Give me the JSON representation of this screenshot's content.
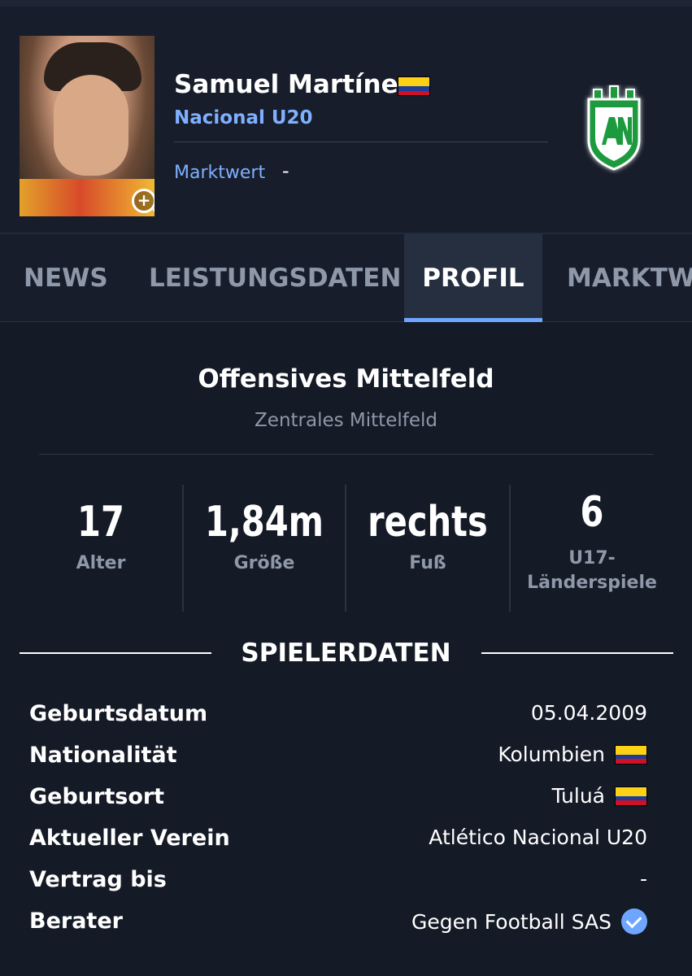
{
  "player": {
    "name": "Samuel Martínez",
    "club": "Nacional U20",
    "market_value_label": "Marktwert",
    "market_value": "-"
  },
  "colors": {
    "background": "#141a26",
    "accent": "#6ea6ff",
    "link": "#7fb0ff",
    "muted": "#8e98a8",
    "flag_yellow": "#fcd116",
    "flag_blue": "#1f3c97",
    "flag_red": "#ce1126",
    "crest_green": "#1a9a3c"
  },
  "icons": {
    "zoom": "zoom-in-icon",
    "verified": "check-circle-icon",
    "crest": "atletico-nacional-crest-icon"
  },
  "tabs": [
    {
      "label": "NEWS",
      "active": false
    },
    {
      "label": "LEISTUNGSDATEN",
      "active": false
    },
    {
      "label": "PROFIL",
      "active": true
    },
    {
      "label": "MARKTW",
      "active": false
    }
  ],
  "position": {
    "main": "Offensives Mittelfeld",
    "secondary": "Zentrales Mittelfeld"
  },
  "stats": [
    {
      "value": "17",
      "label": "Alter"
    },
    {
      "value": "1,84m",
      "label": "Größe"
    },
    {
      "value": "rechts",
      "label": "Fuß"
    },
    {
      "value": "6",
      "label": "U17-\nLänderspiele"
    }
  ],
  "section_title": "SPIELERDATEN",
  "details": [
    {
      "key": "Geburtsdatum",
      "value": "05.04.2009"
    },
    {
      "key": "Nationalität",
      "value": "Kolumbien"
    },
    {
      "key": "Geburtsort",
      "value": "Tuluá"
    },
    {
      "key": "Aktueller Verein",
      "value": "Atlético Nacional U20"
    },
    {
      "key": "Vertrag bis",
      "value": "-"
    },
    {
      "key": "Berater",
      "value": "Gegen Football SAS"
    }
  ]
}
